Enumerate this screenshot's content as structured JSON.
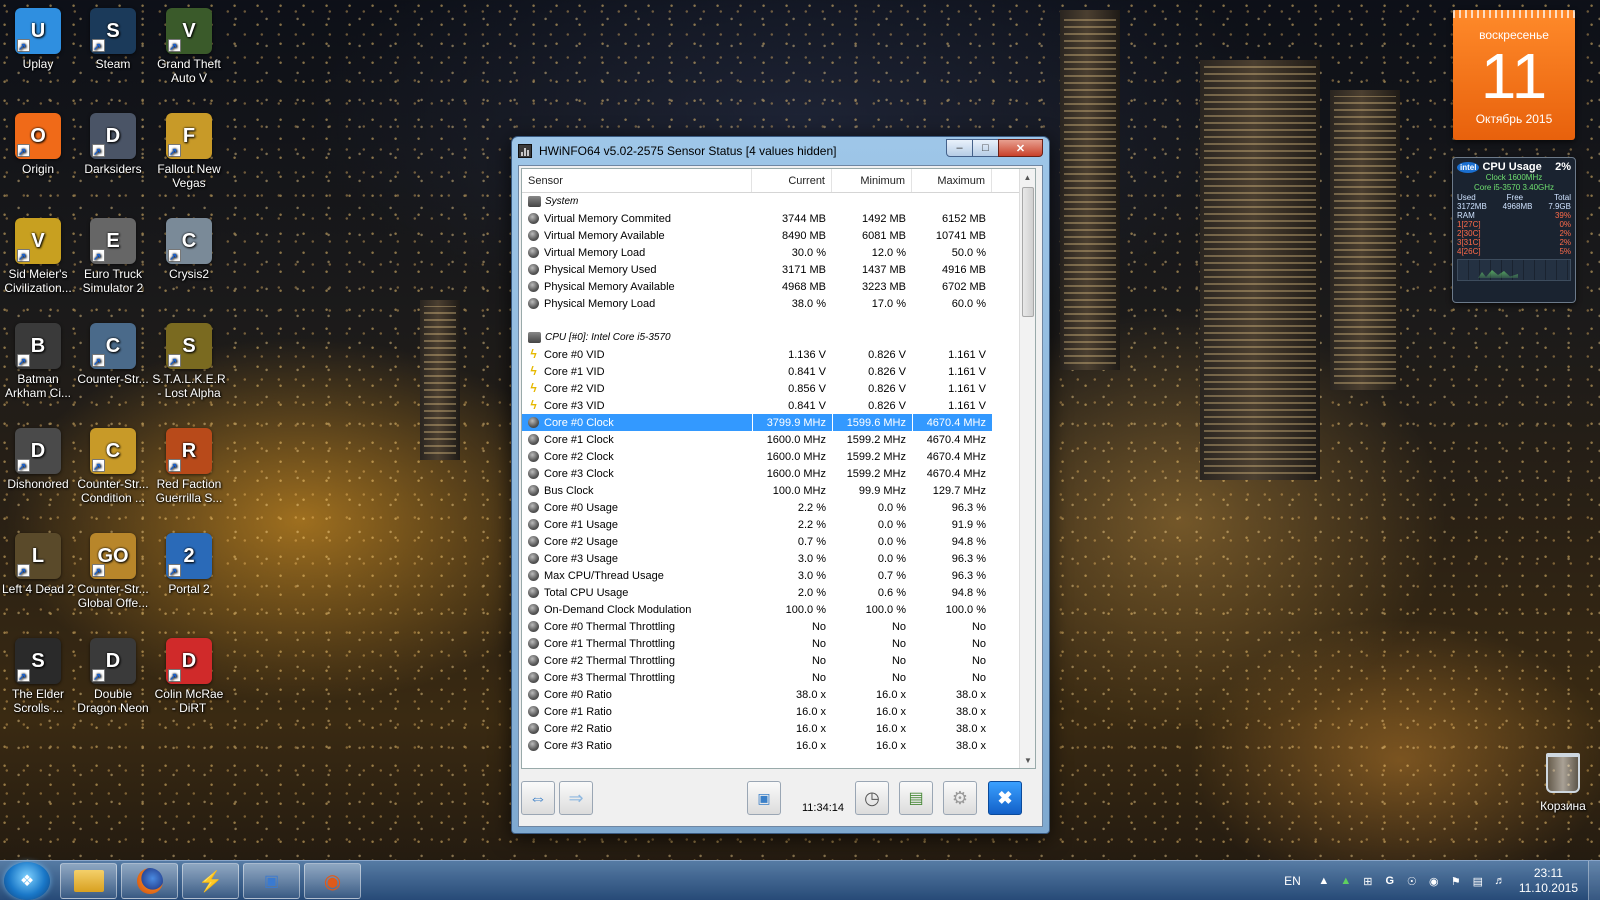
{
  "desktop_icons": [
    {
      "label_1": "Uplay",
      "label_2": "",
      "color": "#2f8fe0",
      "glyph": "U"
    },
    {
      "label_1": "Steam",
      "label_2": "",
      "color": "#1b3a5a",
      "glyph": "S"
    },
    {
      "label_1": "Grand Theft",
      "label_2": "Auto V",
      "color": "#3a5a2a",
      "glyph": "V"
    },
    {
      "label_1": "Origin",
      "label_2": "",
      "color": "#f06a18",
      "glyph": "O"
    },
    {
      "label_1": "Darksiders",
      "label_2": "",
      "color": "#4a5466",
      "glyph": "D"
    },
    {
      "label_1": "Fallout New",
      "label_2": "Vegas",
      "color": "#c89a28",
      "glyph": "F"
    },
    {
      "label_1": "Sid Meier's",
      "label_2": "Civilization...",
      "color": "#c8a020",
      "glyph": "V"
    },
    {
      "label_1": "Euro Truck",
      "label_2": "Simulator 2",
      "color": "#666666",
      "glyph": "E"
    },
    {
      "label_1": "Crysis2",
      "label_2": "",
      "color": "#7a8a98",
      "glyph": "C"
    },
    {
      "label_1": "Batman",
      "label_2": "Arkham Ci...",
      "color": "#3a3a3a",
      "glyph": "B"
    },
    {
      "label_1": "Counter-Str...",
      "label_2": "",
      "color": "#4a6a8a",
      "glyph": "C"
    },
    {
      "label_1": "S.T.A.L.K.E.R",
      "label_2": "- Lost Alpha",
      "color": "#7a6a20",
      "glyph": "S"
    },
    {
      "label_1": "Dishonored",
      "label_2": "",
      "color": "#4a4a4a",
      "glyph": "D"
    },
    {
      "label_1": "Counter-Str...",
      "label_2": "Condition ...",
      "color": "#c89a28",
      "glyph": "C"
    },
    {
      "label_1": "Red Faction",
      "label_2": "Guerrilla S...",
      "color": "#b84a1a",
      "glyph": "R"
    },
    {
      "label_1": "Left 4 Dead 2",
      "label_2": "",
      "color": "#5a4a2a",
      "glyph": "L"
    },
    {
      "label_1": "Counter-Str...",
      "label_2": "Global Offe...",
      "color": "#b8862a",
      "glyph": "GO"
    },
    {
      "label_1": "Portal 2",
      "label_2": "",
      "color": "#2a6ab8",
      "glyph": "2"
    },
    {
      "label_1": "The Elder",
      "label_2": "Scrolls ...",
      "color": "#2a2a2a",
      "glyph": "S"
    },
    {
      "label_1": "Double",
      "label_2": "Dragon Neon",
      "color": "#3a3a3a",
      "glyph": "D"
    },
    {
      "label_1": "Colin McRae",
      "label_2": "- DiRT",
      "color": "#d02a2a",
      "glyph": "D"
    }
  ],
  "calendar": {
    "weekday": "воскресенье",
    "day": "11",
    "month_year": "Октябрь 2015"
  },
  "cpu_gadget": {
    "title": "CPU Usage",
    "usage": "2%",
    "clock": "Clock 1600MHz",
    "model": "Core i5-3570 3.40GHz",
    "mem_headers": [
      "Used",
      "Free",
      "Total"
    ],
    "mem_values": [
      "3172MB",
      "4968MB",
      "7.9GB"
    ],
    "ram_label": "RAM",
    "ram_value": "39%",
    "cores": [
      {
        "label": "1[27C]",
        "value": "0%"
      },
      {
        "label": "2[30C]",
        "value": "2%"
      },
      {
        "label": "3[31C]",
        "value": "2%"
      },
      {
        "label": "4[26C]",
        "value": "5%"
      }
    ]
  },
  "window": {
    "title": "HWiNFO64 v5.02-2575 Sensor Status [4 values hidden]",
    "columns": [
      "Sensor",
      "Current",
      "Minimum",
      "Maximum"
    ],
    "rows": [
      {
        "type": "group",
        "name": "System",
        "cur": "",
        "min": "",
        "max": ""
      },
      {
        "type": "sensor",
        "name": "Virtual Memory Commited",
        "cur": "3744 MB",
        "min": "1492 MB",
        "max": "6152 MB"
      },
      {
        "type": "sensor",
        "name": "Virtual Memory Available",
        "cur": "8490 MB",
        "min": "6081 MB",
        "max": "10741 MB"
      },
      {
        "type": "sensor",
        "name": "Virtual Memory Load",
        "cur": "30.0 %",
        "min": "12.0 %",
        "max": "50.0 %"
      },
      {
        "type": "sensor",
        "name": "Physical Memory Used",
        "cur": "3171 MB",
        "min": "1437 MB",
        "max": "4916 MB"
      },
      {
        "type": "sensor",
        "name": "Physical Memory Available",
        "cur": "4968 MB",
        "min": "3223 MB",
        "max": "6702 MB"
      },
      {
        "type": "sensor",
        "name": "Physical Memory Load",
        "cur": "38.0 %",
        "min": "17.0 %",
        "max": "60.0 %"
      },
      {
        "type": "blank",
        "name": "",
        "cur": "",
        "min": "",
        "max": ""
      },
      {
        "type": "group",
        "name": "CPU [#0]: Intel Core i5-3570",
        "cur": "",
        "min": "",
        "max": ""
      },
      {
        "type": "volt",
        "name": "Core #0 VID",
        "cur": "1.136 V",
        "min": "0.826 V",
        "max": "1.161 V"
      },
      {
        "type": "volt",
        "name": "Core #1 VID",
        "cur": "0.841 V",
        "min": "0.826 V",
        "max": "1.161 V"
      },
      {
        "type": "volt",
        "name": "Core #2 VID",
        "cur": "0.856 V",
        "min": "0.826 V",
        "max": "1.161 V"
      },
      {
        "type": "volt",
        "name": "Core #3 VID",
        "cur": "0.841 V",
        "min": "0.826 V",
        "max": "1.161 V"
      },
      {
        "type": "sensor",
        "name": "Core #0 Clock",
        "cur": "3799.9 MHz",
        "min": "1599.6 MHz",
        "max": "4670.4 MHz",
        "selected": true
      },
      {
        "type": "sensor",
        "name": "Core #1 Clock",
        "cur": "1600.0 MHz",
        "min": "1599.2 MHz",
        "max": "4670.4 MHz"
      },
      {
        "type": "sensor",
        "name": "Core #2 Clock",
        "cur": "1600.0 MHz",
        "min": "1599.2 MHz",
        "max": "4670.4 MHz"
      },
      {
        "type": "sensor",
        "name": "Core #3 Clock",
        "cur": "1600.0 MHz",
        "min": "1599.2 MHz",
        "max": "4670.4 MHz"
      },
      {
        "type": "sensor",
        "name": "Bus Clock",
        "cur": "100.0 MHz",
        "min": "99.9 MHz",
        "max": "129.7 MHz"
      },
      {
        "type": "sensor",
        "name": "Core #0 Usage",
        "cur": "2.2 %",
        "min": "0.0 %",
        "max": "96.3 %"
      },
      {
        "type": "sensor",
        "name": "Core #1 Usage",
        "cur": "2.2 %",
        "min": "0.0 %",
        "max": "91.9 %"
      },
      {
        "type": "sensor",
        "name": "Core #2 Usage",
        "cur": "0.7 %",
        "min": "0.0 %",
        "max": "94.8 %"
      },
      {
        "type": "sensor",
        "name": "Core #3 Usage",
        "cur": "3.0 %",
        "min": "0.0 %",
        "max": "96.3 %"
      },
      {
        "type": "sensor",
        "name": "Max CPU/Thread Usage",
        "cur": "3.0 %",
        "min": "0.7 %",
        "max": "96.3 %"
      },
      {
        "type": "sensor",
        "name": "Total CPU Usage",
        "cur": "2.0 %",
        "min": "0.6 %",
        "max": "94.8 %"
      },
      {
        "type": "sensor",
        "name": "On-Demand Clock Modulation",
        "cur": "100.0 %",
        "min": "100.0 %",
        "max": "100.0 %"
      },
      {
        "type": "sensor",
        "name": "Core #0 Thermal Throttling",
        "cur": "No",
        "min": "No",
        "max": "No"
      },
      {
        "type": "sensor",
        "name": "Core #1 Thermal Throttling",
        "cur": "No",
        "min": "No",
        "max": "No"
      },
      {
        "type": "sensor",
        "name": "Core #2 Thermal Throttling",
        "cur": "No",
        "min": "No",
        "max": "No"
      },
      {
        "type": "sensor",
        "name": "Core #3 Thermal Throttling",
        "cur": "No",
        "min": "No",
        "max": "No"
      },
      {
        "type": "sensor",
        "name": "Core #0 Ratio",
        "cur": "38.0 x",
        "min": "16.0 x",
        "max": "38.0 x"
      },
      {
        "type": "sensor",
        "name": "Core #1 Ratio",
        "cur": "16.0 x",
        "min": "16.0 x",
        "max": "38.0 x"
      },
      {
        "type": "sensor",
        "name": "Core #2 Ratio",
        "cur": "16.0 x",
        "min": "16.0 x",
        "max": "38.0 x"
      },
      {
        "type": "sensor",
        "name": "Core #3 Ratio",
        "cur": "16.0 x",
        "min": "16.0 x",
        "max": "38.0 x"
      }
    ],
    "toolbar": {
      "time": "11:34:14",
      "icons": [
        "expand-arrows-icon",
        "collapse-arrows-icon",
        "network-icon",
        "clock-icon",
        "log-icon",
        "settings-icon",
        "close-icon"
      ]
    }
  },
  "recycle_bin": {
    "label": "Корзина"
  },
  "taskbar": {
    "pinned": [
      "explorer-icon",
      "firefox-icon",
      "msi-afterburner-icon",
      "network-tool-icon",
      "hwinfo-icon"
    ],
    "lang": "EN",
    "time": "23:11",
    "date": "11.10.2015"
  },
  "colors": {
    "selection": "#3399ff",
    "calendar": "#f07a1e",
    "taskbar": "#3e6fa3"
  }
}
